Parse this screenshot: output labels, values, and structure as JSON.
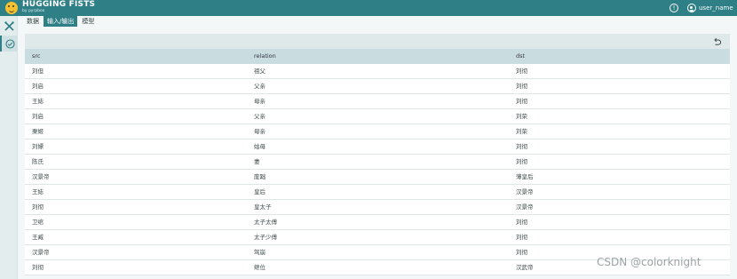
{
  "brand": {
    "title": "HUGGING FISTS",
    "subtitle": "by pyrpbox",
    "accent": "#2f7f86"
  },
  "header": {
    "user_name": "user_name",
    "help_icon": "info-icon",
    "user_icon": "user-circle-icon"
  },
  "sidebar": {
    "items": [
      {
        "icon": "tools-cross-icon"
      },
      {
        "icon": "check-circle-icon",
        "active": true
      }
    ]
  },
  "tabs": [
    {
      "label": "数据",
      "active": false
    },
    {
      "label": "输入/输出",
      "active": true
    },
    {
      "label": "模型",
      "active": false
    }
  ],
  "toolbar": {
    "undo_icon": "undo-icon"
  },
  "table": {
    "columns": [
      "src",
      "relation",
      "dst"
    ],
    "rows": [
      [
        "刘但",
        "祖父",
        "刘彻"
      ],
      [
        "刘启",
        "父亲",
        "刘彻"
      ],
      [
        "王娡",
        "母亲",
        "刘彻"
      ],
      [
        "刘启",
        "父亲",
        "刘荣"
      ],
      [
        "栗姬",
        "母亲",
        "刘荣"
      ],
      [
        "刘嫖",
        "姑母",
        "刘彻"
      ],
      [
        "陈氏",
        "妻",
        "刘彻"
      ],
      [
        "汉景帝",
        "废黜",
        "薄皇后"
      ],
      [
        "王娡",
        "皇后",
        "汉景帝"
      ],
      [
        "刘彻",
        "皇太子",
        "汉景帝"
      ],
      [
        "卫绾",
        "太子太傅",
        "刘彻"
      ],
      [
        "王臧",
        "太子少傅",
        "刘彻"
      ],
      [
        "汉景帝",
        "驾崩",
        "刘彻"
      ],
      [
        "刘彻",
        "继位",
        "汉武帝"
      ]
    ]
  },
  "watermark": "CSDN @colorknight"
}
